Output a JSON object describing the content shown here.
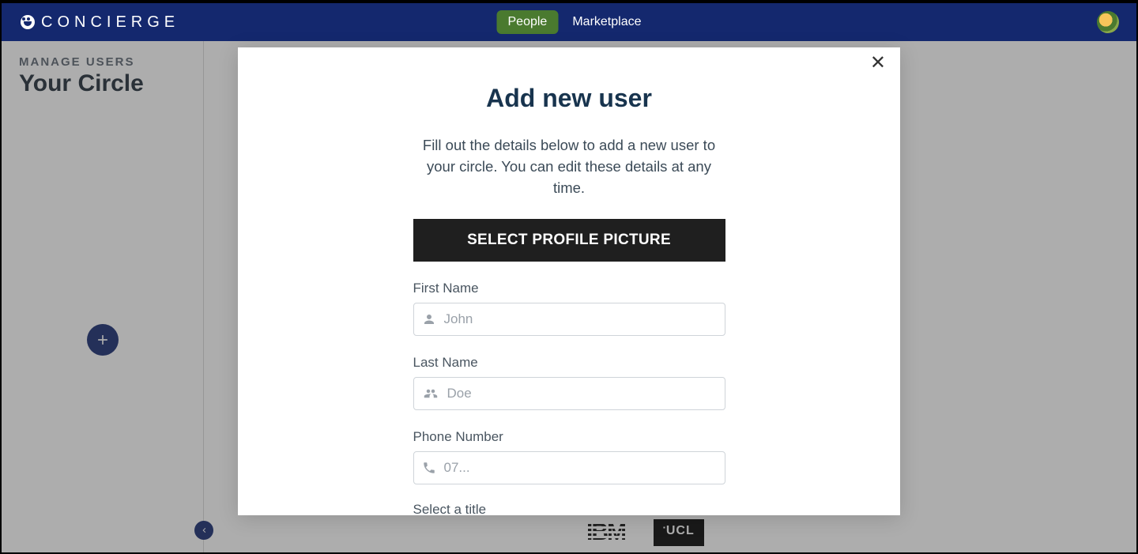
{
  "header": {
    "brand": "CONCIERGE",
    "nav": {
      "people": "People",
      "marketplace": "Marketplace"
    }
  },
  "sidebar": {
    "eyebrow": "MANAGE USERS",
    "title": "Your Circle"
  },
  "modal": {
    "title": "Add new user",
    "description": "Fill out the details below to add a new user to your circle. You can edit these details at any time.",
    "select_picture_label": "SELECT PROFILE PICTURE",
    "fields": {
      "first_name": {
        "label": "First Name",
        "placeholder": "John",
        "value": ""
      },
      "last_name": {
        "label": "Last Name",
        "placeholder": "Doe",
        "value": ""
      },
      "phone": {
        "label": "Phone Number",
        "placeholder": "07...",
        "value": ""
      },
      "title_select": {
        "label": "Select a title"
      }
    }
  },
  "footer_logos": {
    "ibm": "IBM",
    "ucl": "UCL"
  },
  "colors": {
    "header_bg": "#14286e",
    "accent_green": "#4a7a2f",
    "modal_title": "#18344e",
    "primary_blue": "#1443d6"
  }
}
